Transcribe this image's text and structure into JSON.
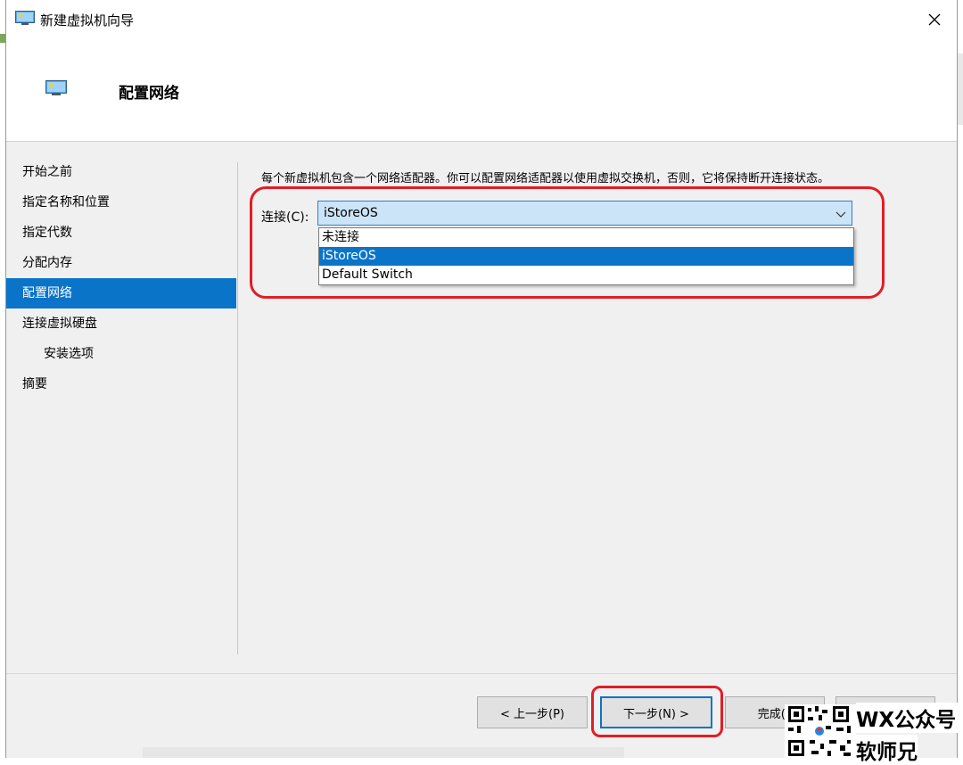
{
  "window": {
    "title": "新建虚拟机向导",
    "header_title": "配置网络"
  },
  "nav": {
    "items": [
      {
        "label": "开始之前"
      },
      {
        "label": "指定名称和位置"
      },
      {
        "label": "指定代数"
      },
      {
        "label": "分配内存"
      },
      {
        "label": "配置网络"
      },
      {
        "label": "连接虚拟硬盘"
      },
      {
        "label": "安装选项"
      },
      {
        "label": "摘要"
      }
    ],
    "active_index": 4
  },
  "content": {
    "description": "每个新虚拟机包含一个网络适配器。你可以配置网络适配器以使用虚拟交换机，否则，它将保持断开连接状态。",
    "connection_label": "连接(C):",
    "connection_value": "iStoreOS",
    "options": [
      "未连接",
      "iStoreOS",
      "Default Switch"
    ],
    "selected_option": "iStoreOS"
  },
  "buttons": {
    "prev": "< 上一步(P)",
    "next": "下一步(N) >",
    "finish": "完成(F"
  },
  "watermark": {
    "line1": "WX公众号",
    "line2": "软师兄"
  },
  "colors": {
    "accent": "#0a74c9",
    "highlight": "#e21d25",
    "combo_bg": "#cce4f7"
  }
}
